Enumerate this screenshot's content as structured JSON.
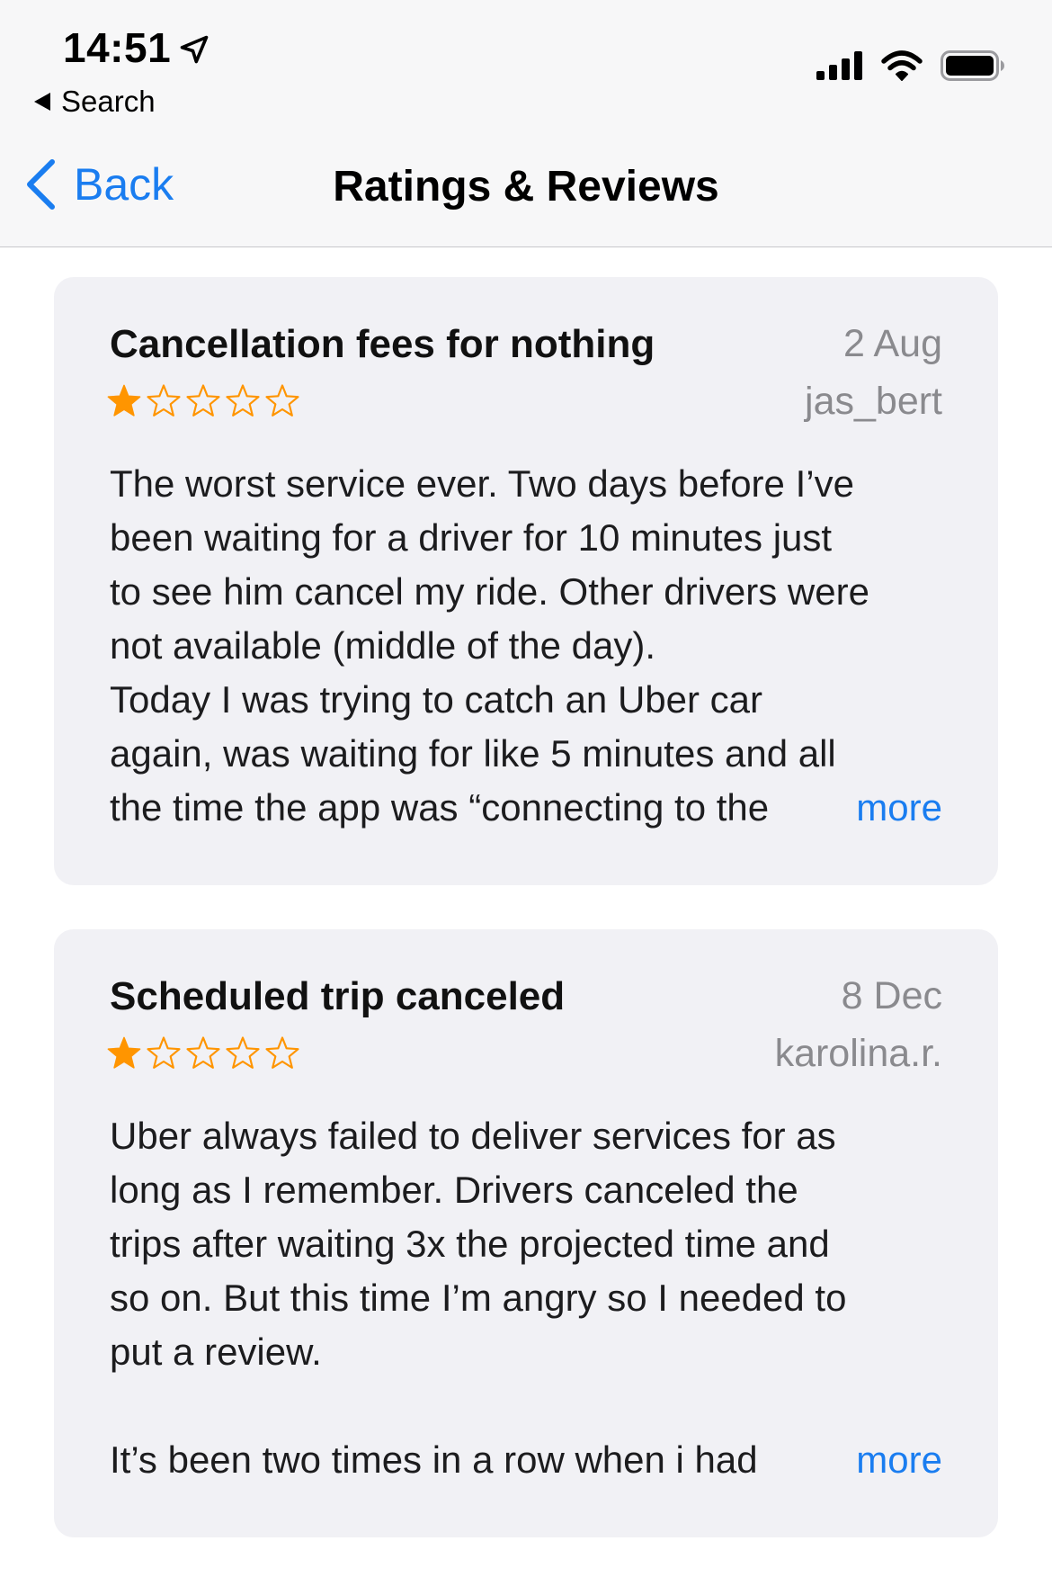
{
  "status_bar": {
    "time": "14:51",
    "back_to_app": "Search"
  },
  "nav": {
    "back_label": "Back",
    "title": "Ratings & Reviews"
  },
  "colors": {
    "accent": "#1a7df0",
    "star": "#ff9500",
    "card_bg": "#f1f1f5",
    "secondary_text": "#8a8a8e"
  },
  "reviews": [
    {
      "title": "Cancellation fees for nothing",
      "date": "2 Aug",
      "author": "jas_bert",
      "rating": 1,
      "max_rating": 5,
      "body": "The worst service ever. Two days before I’ve\nbeen waiting for a driver for 10 minutes just\nto see him cancel my ride. Other drivers were\nnot available (middle of the day).\nToday I was trying to catch an Uber car\nagain, was waiting for like 5 minutes and all",
      "last_line": "the time the app was “connecting to the",
      "more_label": "more"
    },
    {
      "title": "Scheduled trip canceled",
      "date": "8 Dec",
      "author": "karolina.r.",
      "rating": 1,
      "max_rating": 5,
      "body": "Uber always failed to deliver services for as\nlong as I remember. Drivers canceled the\ntrips after waiting 3x the projected time and\nso on. But this time I’m angry so I needed to\nput a review.\n",
      "last_line": "It’s been two times in a row when i had",
      "more_label": "more"
    }
  ]
}
